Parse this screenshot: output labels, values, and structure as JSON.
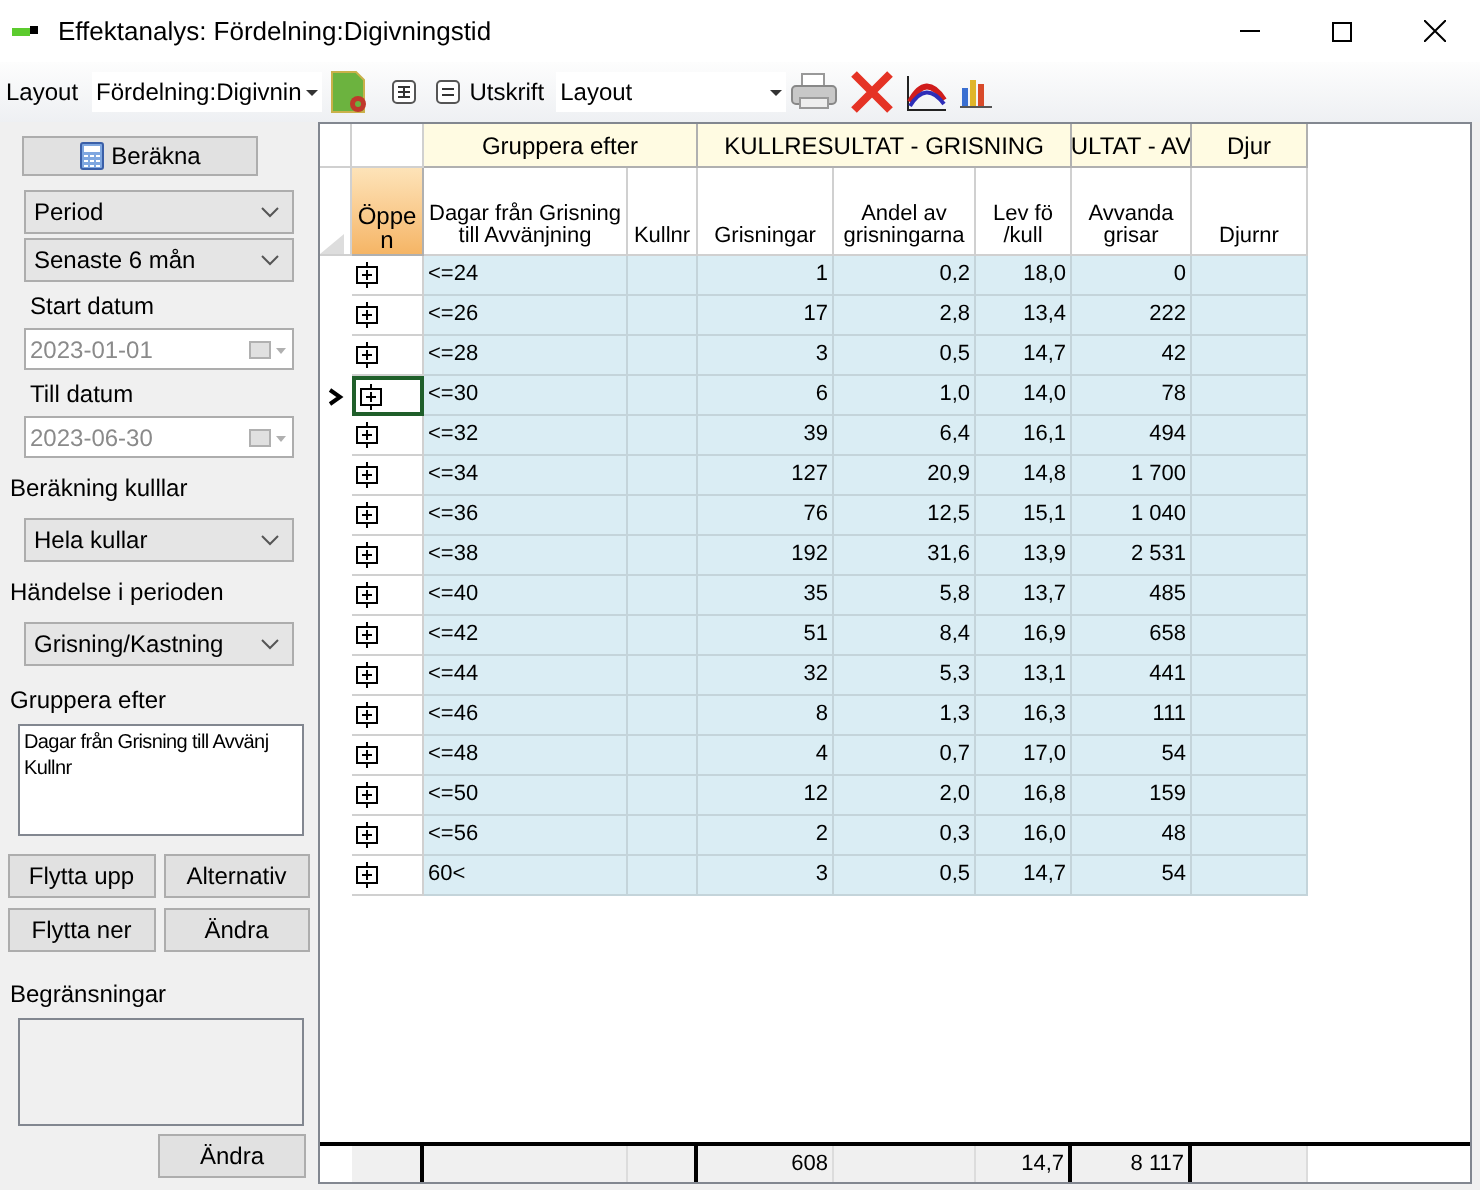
{
  "window": {
    "title": "Effektanalys: Fördelning:Digivningstid"
  },
  "toolbar": {
    "layout_label": "Layout",
    "layout_value": "Fördelning:Digivnin",
    "print_label": "Utskrift",
    "print_value": "Layout"
  },
  "sidebar": {
    "calculate_button": "Beräkna",
    "period_select": "Period",
    "range_select": "Senaste 6 mån",
    "start_label": "Start datum",
    "start_date": "2023-01-01",
    "end_label": "Till datum",
    "end_date": "2023-06-30",
    "litter_calc_label": "Beräkning kulllar",
    "litter_calc_select": "Hela kullar",
    "event_label": "Händelse i perioden",
    "event_select": "Grisning/Kastning",
    "group_label": "Gruppera efter",
    "group_items": [
      "Dagar från Grisning till Avvänj",
      "Kullnr"
    ],
    "buttons": [
      "Flytta upp",
      "Alternativ",
      "Flytta ner",
      "Ändra"
    ],
    "limits_label": "Begränsningar",
    "limits_button": "Ändra"
  },
  "table": {
    "open_header": "Öppen",
    "groups": [
      {
        "label": "Gruppera efter",
        "columns": [
          {
            "label": "Dagar från Grisning till Avvänjning",
            "kind": "label"
          },
          {
            "label": "Kullnr",
            "kind": "blank"
          }
        ]
      },
      {
        "label": "KULLRESULTAT - GRISNING",
        "columns": [
          {
            "label": "Grisningar",
            "kind": "number",
            "total": "608"
          },
          {
            "label": "Andel av grisningarna",
            "kind": "number"
          },
          {
            "label": "Lev fö /kull",
            "kind": "number",
            "total": "14,7"
          }
        ]
      },
      {
        "label": "ULTAT - AV",
        "columns": [
          {
            "label": "Avvanda grisar",
            "kind": "number",
            "total": "8 117"
          }
        ]
      },
      {
        "label": "Djur",
        "columns": [
          {
            "label": "Djurnr",
            "kind": "blank"
          }
        ]
      }
    ],
    "rows": [
      {
        "selected": false,
        "label": "<=24",
        "values": [
          "1",
          "0,2",
          "18,0",
          "0"
        ]
      },
      {
        "selected": false,
        "label": "<=26",
        "values": [
          "17",
          "2,8",
          "13,4",
          "222"
        ]
      },
      {
        "selected": false,
        "label": "<=28",
        "values": [
          "3",
          "0,5",
          "14,7",
          "42"
        ]
      },
      {
        "selected": true,
        "label": "<=30",
        "values": [
          "6",
          "1,0",
          "14,0",
          "78"
        ]
      },
      {
        "selected": false,
        "label": "<=32",
        "values": [
          "39",
          "6,4",
          "16,1",
          "494"
        ]
      },
      {
        "selected": false,
        "label": "<=34",
        "values": [
          "127",
          "20,9",
          "14,8",
          "1 700"
        ]
      },
      {
        "selected": false,
        "label": "<=36",
        "values": [
          "76",
          "12,5",
          "15,1",
          "1 040"
        ]
      },
      {
        "selected": false,
        "label": "<=38",
        "values": [
          "192",
          "31,6",
          "13,9",
          "2 531"
        ]
      },
      {
        "selected": false,
        "label": "<=40",
        "values": [
          "35",
          "5,8",
          "13,7",
          "485"
        ]
      },
      {
        "selected": false,
        "label": "<=42",
        "values": [
          "51",
          "8,4",
          "16,9",
          "658"
        ]
      },
      {
        "selected": false,
        "label": "<=44",
        "values": [
          "32",
          "5,3",
          "13,1",
          "441"
        ]
      },
      {
        "selected": false,
        "label": "<=46",
        "values": [
          "8",
          "1,3",
          "16,3",
          "111"
        ]
      },
      {
        "selected": false,
        "label": "<=48",
        "values": [
          "4",
          "0,7",
          "17,0",
          "54"
        ]
      },
      {
        "selected": false,
        "label": "<=50",
        "values": [
          "12",
          "2,0",
          "16,8",
          "159"
        ]
      },
      {
        "selected": false,
        "label": "<=56",
        "values": [
          "2",
          "0,3",
          "16,0",
          "48"
        ]
      },
      {
        "selected": false,
        "label": "60<",
        "values": [
          "3",
          "0,5",
          "14,7",
          "54"
        ]
      }
    ]
  }
}
